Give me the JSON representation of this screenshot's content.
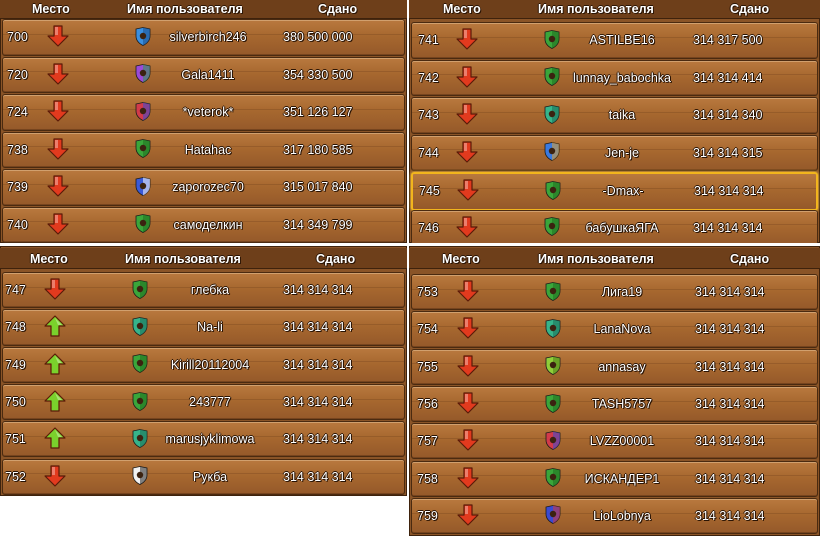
{
  "colors": {
    "down_arrow": "#e23a1e",
    "up_arrow": "#7ad12c",
    "highlight_border": "#f2b51d"
  },
  "panels": [
    {
      "headers": {
        "place": "Место",
        "user": "Имя пользователя",
        "score": "Сдано"
      },
      "rows": [
        {
          "place": "700",
          "trend": "down",
          "badge": "blue-shield-icon",
          "name": "silverbirch246",
          "score": "380 500 000"
        },
        {
          "place": "720",
          "trend": "down",
          "badge": "purple-green-shield-icon",
          "name": "Gala1411",
          "score": "354 330 500"
        },
        {
          "place": "724",
          "trend": "down",
          "badge": "red-blue-crest-icon",
          "name": "*veterok*",
          "score": "351 126 127"
        },
        {
          "place": "738",
          "trend": "down",
          "badge": "green-bear-shield-icon",
          "name": "Hatahac",
          "score": "317 180 585"
        },
        {
          "place": "739",
          "trend": "down",
          "badge": "blue-cross-crest-icon",
          "name": "zaporozec70",
          "score": "315 017 840"
        },
        {
          "place": "740",
          "trend": "down",
          "badge": "green-bear-shield-icon",
          "name": "самоделкин",
          "score": "314 349 799"
        }
      ]
    },
    {
      "headers": {
        "place": "Место",
        "user": "Имя пользователя",
        "score": "Сдано"
      },
      "rows": [
        {
          "place": "741",
          "trend": "down",
          "badge": "green-bear-shield-icon",
          "name": "ASTILBE16",
          "score": "314 317 500"
        },
        {
          "place": "742",
          "trend": "down",
          "badge": "green-bear-shield-icon",
          "name": "lunnay_babochka",
          "score": "314 314 414"
        },
        {
          "place": "743",
          "trend": "down",
          "badge": "teal-bear-shield-icon",
          "name": "taika",
          "score": "314 314 340"
        },
        {
          "place": "744",
          "trend": "down",
          "badge": "blue-striped-shield-icon",
          "name": "Jen-je",
          "score": "314 314 315"
        },
        {
          "place": "745",
          "trend": "down",
          "badge": "green-bear-shield-icon",
          "name": "-Dmax-",
          "score": "314 314 314",
          "highlight": true
        },
        {
          "place": "746",
          "trend": "down",
          "badge": "green-bear-shield-icon",
          "name": "бабушкаЯГА",
          "score": "314 314 314"
        }
      ]
    },
    {
      "headers": {
        "place": "Место",
        "user": "Имя пользователя",
        "score": "Сдано"
      },
      "rows": [
        {
          "place": "747",
          "trend": "down",
          "badge": "green-bear-shield-icon",
          "name": "глебка",
          "score": "314 314 314"
        },
        {
          "place": "748",
          "trend": "up",
          "badge": "teal-bear-shield-icon",
          "name": "Na-li",
          "score": "314 314 314"
        },
        {
          "place": "749",
          "trend": "up",
          "badge": "green-bear-shield-icon",
          "name": "Kirill20112004",
          "score": "314 314 314"
        },
        {
          "place": "750",
          "trend": "up",
          "badge": "green-bear-shield-icon",
          "name": "243777",
          "score": "314 314 314"
        },
        {
          "place": "751",
          "trend": "up",
          "badge": "teal-bear-shield-icon",
          "name": "marusjyklimowa",
          "score": "314 314 314"
        },
        {
          "place": "752",
          "trend": "down",
          "badge": "white-black-crest-icon",
          "name": "Рукба",
          "score": "314 314 314"
        }
      ]
    },
    {
      "headers": {
        "place": "Место",
        "user": "Имя пользователя",
        "score": "Сдано"
      },
      "rows": [
        {
          "place": "753",
          "trend": "down",
          "badge": "green-bear-shield-icon",
          "name": "Лига19",
          "score": "314 314 314"
        },
        {
          "place": "754",
          "trend": "down",
          "badge": "teal-bear-shield-icon",
          "name": "LanaNova",
          "score": "314 314 314"
        },
        {
          "place": "755",
          "trend": "down",
          "badge": "lime-bear-shield-icon",
          "name": "annasay",
          "score": "314 314 314"
        },
        {
          "place": "756",
          "trend": "down",
          "badge": "green-bear-shield-icon",
          "name": "TASH5757",
          "score": "314 314 314"
        },
        {
          "place": "757",
          "trend": "down",
          "badge": "red-blue-crest-icon",
          "name": "LVZZ00001",
          "score": "314 314 314"
        },
        {
          "place": "758",
          "trend": "down",
          "badge": "green-bear-shield-icon",
          "name": "ИСКАНДЕР1",
          "score": "314 314 314"
        },
        {
          "place": "759",
          "trend": "down",
          "badge": "blue-red-shield-icon",
          "name": "LioLobnya",
          "score": "314 314 314"
        }
      ]
    }
  ]
}
